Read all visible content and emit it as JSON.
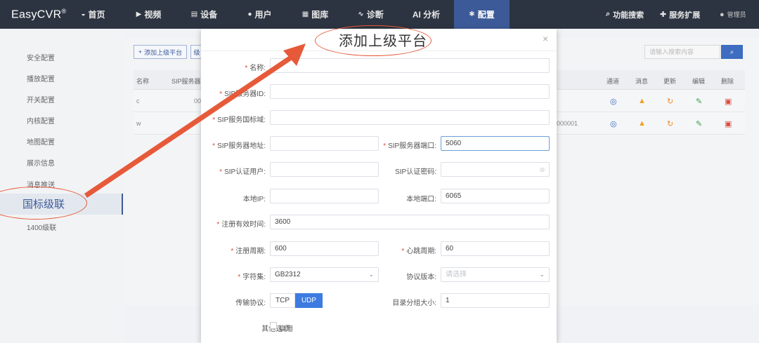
{
  "app": {
    "logo": "EasyCVR",
    "logo_mark": "®"
  },
  "nav": {
    "items": [
      {
        "label": "首页",
        "icon": "dashboard-icon",
        "glyph": "◒"
      },
      {
        "label": "视频",
        "icon": "play-icon",
        "glyph": "▶"
      },
      {
        "label": "设备",
        "icon": "device-icon",
        "glyph": "▤"
      },
      {
        "label": "用户",
        "icon": "user-icon",
        "glyph": "●"
      },
      {
        "label": "图库",
        "icon": "gallery-icon",
        "glyph": "▦"
      },
      {
        "label": "诊断",
        "icon": "pulse-icon",
        "glyph": "∿"
      },
      {
        "label": "AI 分析",
        "icon": "",
        "glyph": ""
      },
      {
        "label": "配置",
        "icon": "gear-icon",
        "glyph": "✱",
        "active": true
      }
    ],
    "search_label": "功能搜索",
    "extend_label": "服务扩展",
    "user_label": "管理员"
  },
  "sidebar": {
    "items": [
      "安全配置",
      "播放配置",
      "开关配置",
      "内核配置",
      "地图配置",
      "展示信息",
      "消息推送",
      "国标级联",
      "1400级联"
    ],
    "active": "国标级联"
  },
  "background": {
    "add_button": "添加上级平台",
    "add_button_2": "级",
    "search_placeholder": "请输入搜索内容",
    "columns": [
      "名称",
      "SIP服务器",
      "通道",
      "消息",
      "更新",
      "编辑",
      "删除"
    ],
    "rows": [
      {
        "name": "c",
        "sip": "00",
        "extra": ""
      },
      {
        "name": "w",
        "sip": "",
        "extra": "000001"
      }
    ]
  },
  "modal": {
    "title": "添加上级平台",
    "close": "×",
    "fields": {
      "name_label": "名称:",
      "sip_id_label": "SIP服务器ID:",
      "sip_domain_label": "SIP服务国标域:",
      "sip_addr_label": "SIP服务器地址:",
      "sip_port_label": "SIP服务器端口:",
      "sip_port_value": "5060",
      "sip_user_label": "SIP认证用户:",
      "sip_pwd_label": "SIP认证密码:",
      "local_ip_label": "本地IP:",
      "local_port_label": "本地端口:",
      "local_port_value": "6065",
      "reg_expire_label": "注册有效时间:",
      "reg_expire_value": "3600",
      "reg_period_label": "注册周期:",
      "reg_period_value": "600",
      "heartbeat_label": "心跳周期:",
      "heartbeat_value": "60",
      "charset_label": "字符集:",
      "charset_value": "GB2312",
      "protocol_version_label": "协议版本:",
      "protocol_version_placeholder": "请选择",
      "transport_label": "传输协议:",
      "transport_tcp": "TCP",
      "transport_udp": "UDP",
      "catalog_size_label": "目录分组大小:",
      "catalog_size_value": "1",
      "other_label": "其他选项:",
      "enable_label": "启用"
    }
  },
  "colors": {
    "nav_bg": "#2d3441",
    "nav_active": "#3d5a98",
    "accent": "#3d7be0",
    "annotation": "#e65a3a",
    "required": "#e04a3a"
  }
}
